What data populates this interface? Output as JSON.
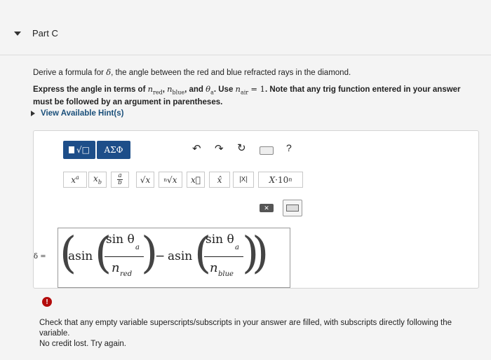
{
  "part": {
    "title": "Part C"
  },
  "question": {
    "prompt_pre": "Derive a formula for ",
    "prompt_symbol": "δ",
    "prompt_post": ", the angle between the red and blue refracted rays in the diamond.",
    "instr_pre": "Express the angle in terms of ",
    "n_red": "n",
    "n_red_sub": "red",
    "n_blue": "n",
    "n_blue_sub": "blue",
    "theta": "θ",
    "theta_sub": "a",
    "use_text": ". Use ",
    "n_air": "n",
    "n_air_sub": "air",
    "n_air_eq": "= 1",
    "instr_post": ". Note that any trig function entered in your answer must be followed by an argument in parentheses."
  },
  "hint": {
    "label": "View Available Hint(s)"
  },
  "toolbar": {
    "template_label": "√□",
    "symbols_label": "ΑΣΦ",
    "undo_icon": "undo-icon",
    "redo_icon": "redo-icon",
    "reset_icon": "reset-icon",
    "keyboard_icon": "keyboard-icon",
    "help_label": "?",
    "row2": [
      {
        "name": "superscript-button",
        "label": "xᵃ"
      },
      {
        "name": "subscript-button",
        "label": "x_b"
      },
      {
        "name": "fraction-button",
        "label": "a/b"
      },
      {
        "name": "sqrt-button",
        "label": "√x"
      },
      {
        "name": "nth-root-button",
        "label": "ⁿ√x"
      },
      {
        "name": "vector-button",
        "label": "x⃗"
      },
      {
        "name": "unit-vector-button",
        "label": "x̂"
      },
      {
        "name": "abs-button",
        "label": "|X|"
      },
      {
        "name": "sci-notation-button",
        "label": "X·10ⁿ"
      }
    ]
  },
  "answer": {
    "lhs": "δ =",
    "fn1": "asin",
    "num1": "sin θ",
    "num1_sub": "a",
    "den1": "n",
    "den1_sub": "red",
    "minus": "−",
    "fn2": "asin",
    "num2": "sin θ",
    "num2_sub": "a",
    "den2": "n",
    "den2_sub": "blue"
  },
  "feedback": {
    "icon": "!",
    "line1": "Check that any empty variable superscripts/subscripts in your answer are filled, with subscripts directly following the variable.",
    "line2": "No credit lost. Try again."
  },
  "colors": {
    "accent": "#1d4e89",
    "error": "#b30b0b",
    "hint": "#1a4f7a"
  }
}
